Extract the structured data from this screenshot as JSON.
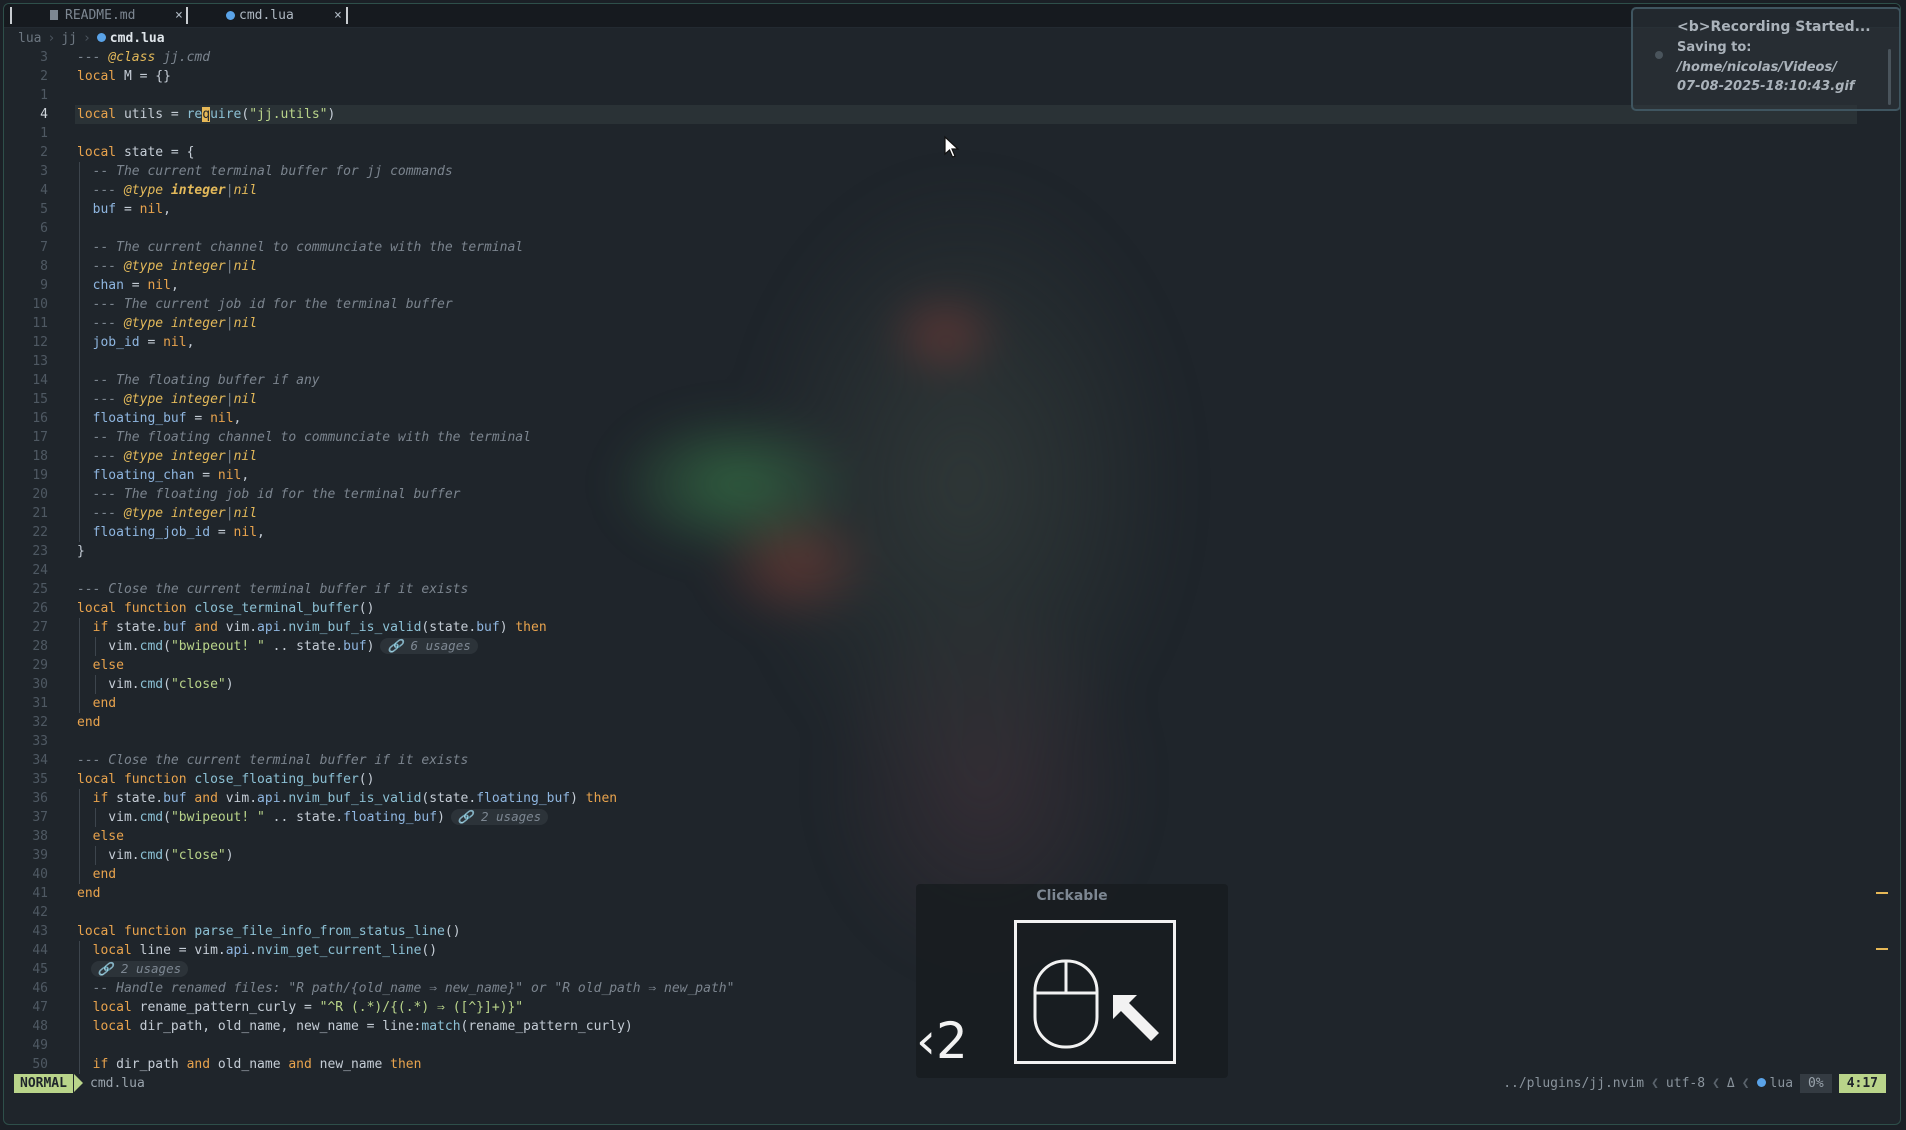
{
  "tabs": [
    {
      "label": "README.md",
      "active": false
    },
    {
      "label": "cmd.lua",
      "active": true
    }
  ],
  "tab_close": "×",
  "breadcrumb": {
    "parts": [
      "lua",
      "jj"
    ],
    "current": "cmd.lua",
    "sep": "›"
  },
  "line_numbers": [
    "3",
    "2",
    "1",
    "4",
    "1",
    "2",
    "3",
    "4",
    "5",
    "6",
    "7",
    "8",
    "9",
    "10",
    "11",
    "12",
    "13",
    "14",
    "15",
    "16",
    "17",
    "18",
    "19",
    "20",
    "21",
    "22",
    "23",
    "24",
    "25",
    "26",
    "27",
    "28",
    "29",
    "30",
    "31",
    "32",
    "33",
    "34",
    "35",
    "36",
    "37",
    "38",
    "39",
    "40",
    "41",
    "42",
    "43",
    "44",
    "45",
    "46",
    "47",
    "48",
    "49",
    "50"
  ],
  "inlay_hints": {
    "h28": "🔗 6 usages",
    "h37": "🔗 2 usages",
    "h45": "🔗 2 usages"
  },
  "notification": {
    "line1": "<b>Recording Started...",
    "line2": "Saving to:",
    "line3": "/home/nicolas/Videos/",
    "line4": "07-08-2025-18:10:43.gif"
  },
  "overlay": {
    "title": "Clickable",
    "count": "‹2"
  },
  "status": {
    "mode": "NORMAL",
    "filename": "cmd.lua",
    "path": "../plugins/jj.nvim",
    "encoding": "utf-8",
    "format_icon": "Δ",
    "filetype": "lua",
    "percent": "0%",
    "position": "4:17"
  },
  "colors": {
    "accent": "#b9d48a",
    "keyword": "#e8a34d",
    "comment": "#7b848e",
    "type": "#e3b95a",
    "string": "#b9d48a"
  }
}
